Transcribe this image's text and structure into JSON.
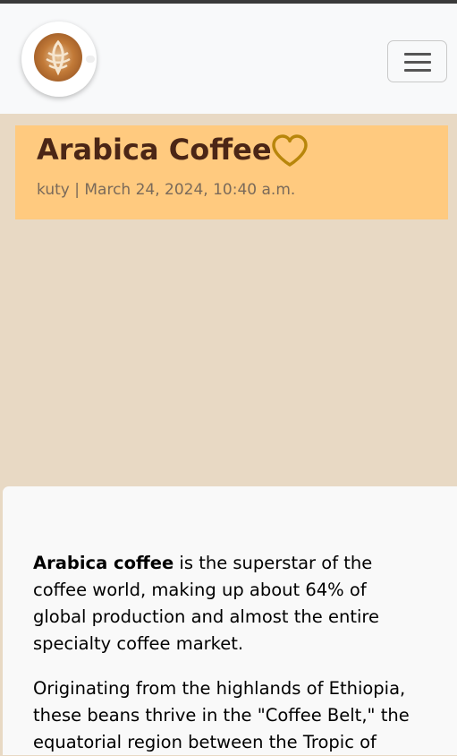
{
  "navbar": {
    "logo_icon": "latte-art-coffee-cup-icon",
    "toggle_icon": "hamburger-menu-icon"
  },
  "post": {
    "title": "Arabica Coffee",
    "favorite_icon": "heart-outline-icon",
    "author": "kuty",
    "separator": " | ",
    "date": "March 24, 2024, 10:40 a.m."
  },
  "content": {
    "p1_bold": "Arabica coffee",
    "p1_line1_rest": " is the superstar of the",
    "p1_line2": "coffee world, making up about 64% of",
    "p1_line3": "global production and almost the entire",
    "p1_line4": "specialty coffee market.",
    "p2_line1": "Originating from the highlands of Ethiopia,",
    "p2_line2": "these beans thrive in the \"Coffee Belt,\" the",
    "p2_line3": "equatorial region between the Tropic of"
  },
  "colors": {
    "page_background": "#e8d9c4",
    "header_card": "#ffca7f",
    "title_text": "#4b2616",
    "heart_stroke": "#b8860b",
    "meta_text": "#7a6a5a"
  }
}
